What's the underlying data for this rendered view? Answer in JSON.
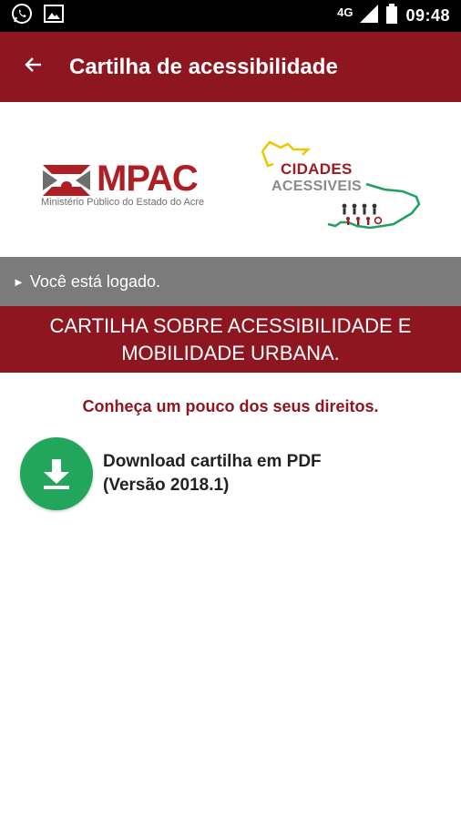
{
  "status_bar": {
    "network": "4G",
    "time": "09:48",
    "icons": [
      "whatsapp-icon",
      "image-icon",
      "signal-icon",
      "battery-icon"
    ]
  },
  "app_bar": {
    "title": "Cartilha de acessibilidade",
    "back_icon": "back-arrow-icon"
  },
  "logos": {
    "mpac": {
      "name": "MPAC",
      "subtitle": "Ministério Público do Estado do Acre"
    },
    "cidades": {
      "line1": "CIDADES",
      "line2": "ACESSIVEIS"
    }
  },
  "session": {
    "marker": "►",
    "text": "Você está logado."
  },
  "banner": {
    "line1": "CARTILHA SOBRE ACESSIBILIDADE E",
    "line2": "MOBILIDADE URBANA."
  },
  "content": {
    "subtitle": "Conheça um pouco dos seus direitos.",
    "download": {
      "line1": "Download cartilha em PDF",
      "line2": "(Versão 2018.1)",
      "icon": "download-icon"
    }
  },
  "colors": {
    "primary": "#8e1620",
    "gray_bar": "#7b7b7b",
    "download_green": "#21a65b",
    "status_bar": "#000000"
  }
}
